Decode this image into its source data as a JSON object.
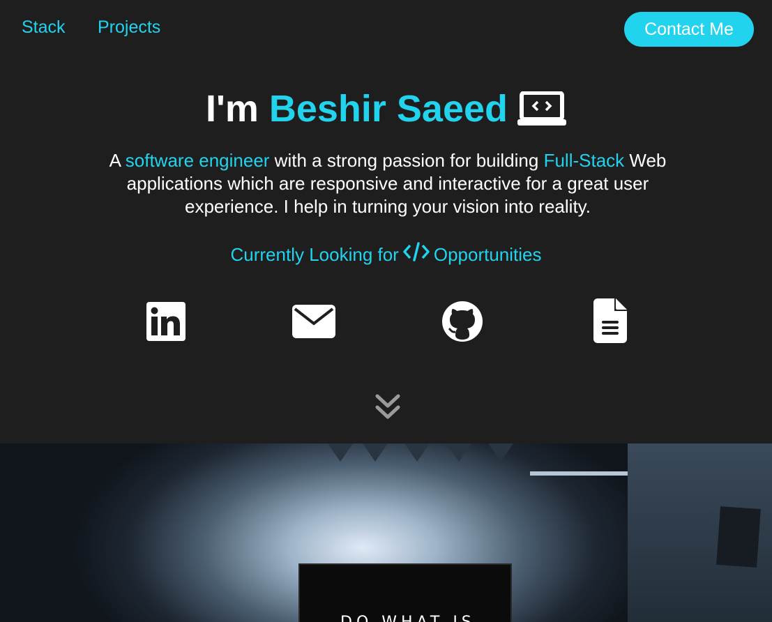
{
  "nav": {
    "links": [
      "Stack",
      "Projects"
    ],
    "contact_label": "Contact Me"
  },
  "hero_text": {
    "title_prefix": "I'm ",
    "name": "Beshir Saeed",
    "title_icon": "laptop-code-icon",
    "intro": {
      "part1": "A ",
      "highlight1": "software engineer",
      "part2": " with a strong passion for building ",
      "highlight2": "Full-Stack",
      "part3": " Web applications which are responsive and interactive for a great user experience. I help in turning your vision into reality."
    },
    "looking_prefix": "Currently Looking for",
    "looking_icon": "code-icon",
    "looking_suffix": "Opportunities"
  },
  "social": [
    {
      "name": "linkedin",
      "icon": "linkedin-icon"
    },
    {
      "name": "email",
      "icon": "envelope-icon"
    },
    {
      "name": "github",
      "icon": "github-icon"
    },
    {
      "name": "resume",
      "icon": "document-icon"
    }
  ],
  "scroll_icon": "chevrons-down-icon",
  "hero_image": {
    "sign_text": "DO WHAT IS"
  },
  "colors": {
    "background": "#1e1e1e",
    "accent": "#22d3ee",
    "text": "#ffffff"
  }
}
